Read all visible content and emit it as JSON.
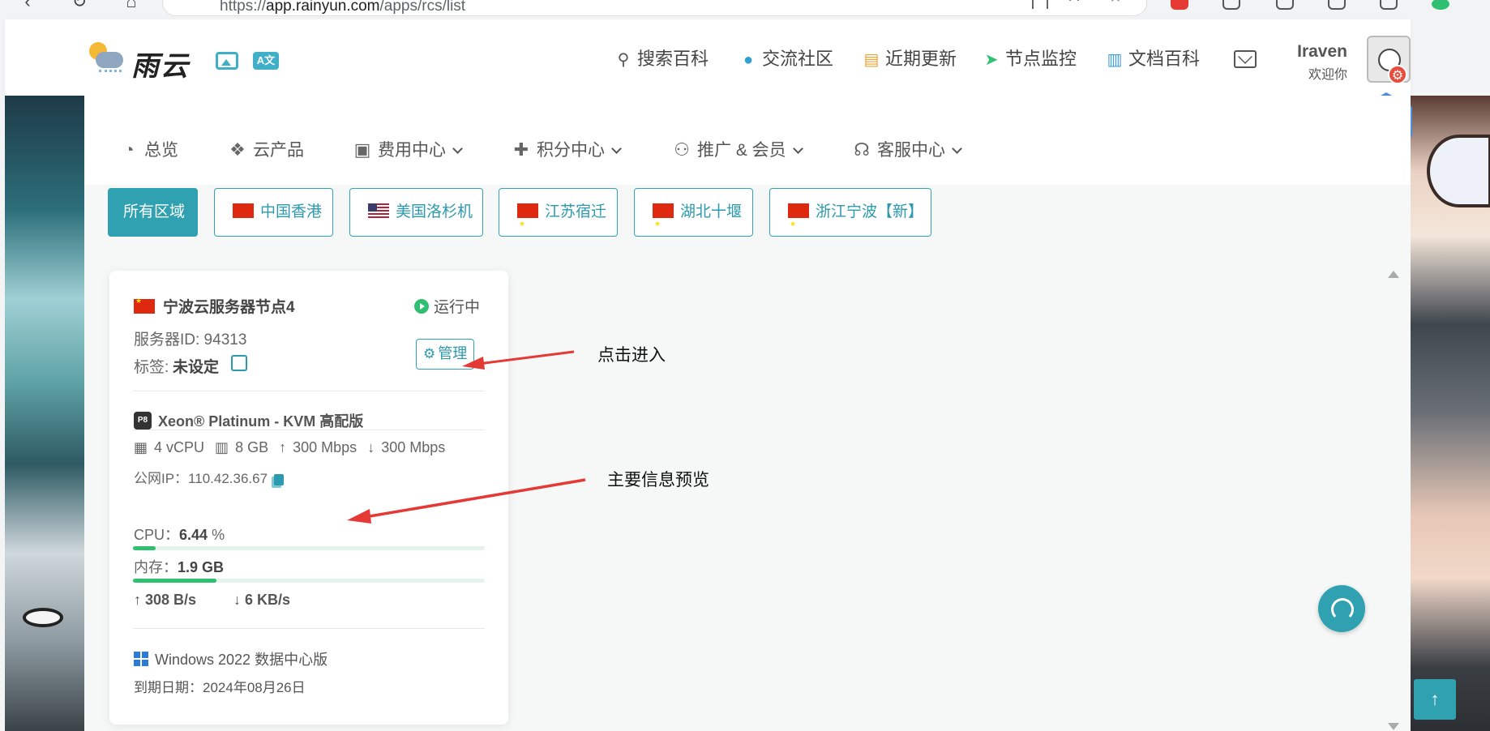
{
  "browser": {
    "url_prefix": "https://",
    "url_host": "app.rainyun.com",
    "url_path": "/apps/rcs/list"
  },
  "header": {
    "logo_text": "雨云",
    "nav": [
      {
        "label": "搜索百科",
        "icon": "search-icon"
      },
      {
        "label": "交流社区",
        "icon": "qq-penguin-icon"
      },
      {
        "label": "近期更新",
        "icon": "news-icon"
      },
      {
        "label": "节点监控",
        "icon": "send-arrow-icon"
      },
      {
        "label": "文档百科",
        "icon": "book-icon"
      }
    ],
    "user_name": "Iraven",
    "user_greeting": "欢迎你"
  },
  "menu": [
    {
      "label": "总览",
      "icon": "dashboard-icon",
      "dropdown": false
    },
    {
      "label": "云产品",
      "icon": "cubes-icon",
      "dropdown": false
    },
    {
      "label": "费用中心",
      "icon": "money-icon",
      "dropdown": true
    },
    {
      "label": "积分中心",
      "icon": "gift-icon",
      "dropdown": true
    },
    {
      "label": "推广 & 会员",
      "icon": "users-icon",
      "dropdown": true
    },
    {
      "label": "客服中心",
      "icon": "headset-icon",
      "dropdown": true
    }
  ],
  "regions": [
    {
      "label": "所有区域",
      "flag": "",
      "active": true
    },
    {
      "label": "中国香港",
      "flag": "hk",
      "active": false
    },
    {
      "label": "美国洛杉机",
      "flag": "us",
      "active": false
    },
    {
      "label": "江苏宿迁",
      "flag": "cn",
      "active": false
    },
    {
      "label": "湖北十堰",
      "flag": "cn",
      "active": false
    },
    {
      "label": "浙江宁波【新】",
      "flag": "cn",
      "active": false
    }
  ],
  "server": {
    "name": "宁波云服务器节点4",
    "status": "运行中",
    "id_label": "服务器ID: 94313",
    "tag_label": "标签:",
    "tag_value": "未设定",
    "manage_label": "管理",
    "cpu_chip": "P8",
    "cpu_model": "Xeon® Platinum - KVM 高配版",
    "specs": {
      "vcpu": "4 vCPU",
      "ram": "8 GB",
      "up_bw": "300 Mbps",
      "down_bw": "300 Mbps"
    },
    "ip_label": "公网IP：110.42.36.67",
    "cpu_usage_label": "CPU：",
    "cpu_usage_value": "6.44",
    "cpu_usage_unit": " %",
    "cpu_usage_fraction": 0.0644,
    "mem_label": "内存：",
    "mem_value": "1.9 GB",
    "mem_fraction": 0.2375,
    "net_up": "308 B/s",
    "net_down": "6 KB/s",
    "os": "Windows 2022 数据中心版",
    "expire": "到期日期：2024年08月26日"
  },
  "annotations": {
    "click_enter": "点击进入",
    "main_info": "主要信息预览"
  },
  "colors": {
    "accent": "#2fa1b0",
    "status_green": "#2fbf71",
    "arrow_red": "#e53935"
  }
}
